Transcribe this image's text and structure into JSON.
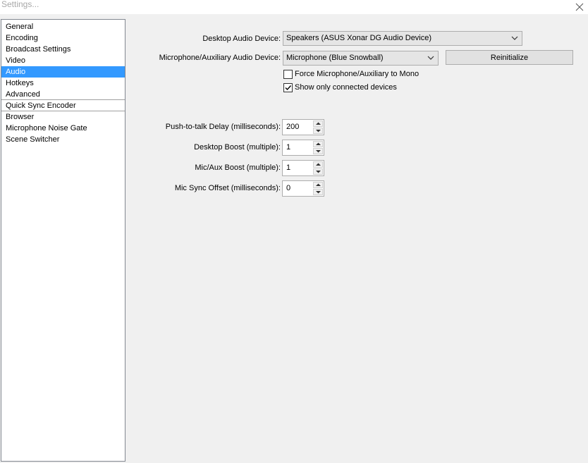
{
  "window": {
    "title": "Settings..."
  },
  "sidebar": {
    "items": [
      {
        "label": "General"
      },
      {
        "label": "Encoding"
      },
      {
        "label": "Broadcast Settings"
      },
      {
        "label": "Video"
      },
      {
        "label": "Audio",
        "selected": true
      },
      {
        "label": "Hotkeys"
      },
      {
        "label": "Advanced"
      },
      {
        "label": "Quick Sync Encoder"
      },
      {
        "label": "Browser"
      },
      {
        "label": "Microphone Noise Gate"
      },
      {
        "label": "Scene Switcher"
      }
    ]
  },
  "audio": {
    "desktop_device": {
      "label": "Desktop Audio Device:",
      "value": "Speakers (ASUS Xonar DG Audio Device)"
    },
    "mic_device": {
      "label": "Microphone/Auxiliary Audio Device:",
      "value": "Microphone (Blue Snowball)"
    },
    "reinitialize_label": "Reinitialize",
    "force_mono": {
      "label": "Force Microphone/Auxiliary to Mono",
      "checked": false
    },
    "show_connected": {
      "label": "Show only connected devices",
      "checked": true
    },
    "push_to_talk_delay": {
      "label": "Push-to-talk Delay (milliseconds):",
      "value": "200"
    },
    "desktop_boost": {
      "label": "Desktop Boost (multiple):",
      "value": "1"
    },
    "mic_aux_boost": {
      "label": "Mic/Aux Boost (multiple):",
      "value": "1"
    },
    "mic_sync_offset": {
      "label": "Mic Sync Offset (milliseconds):",
      "value": "0"
    }
  },
  "colors": {
    "selection": "#3399ff",
    "background": "#f0f0f0"
  }
}
